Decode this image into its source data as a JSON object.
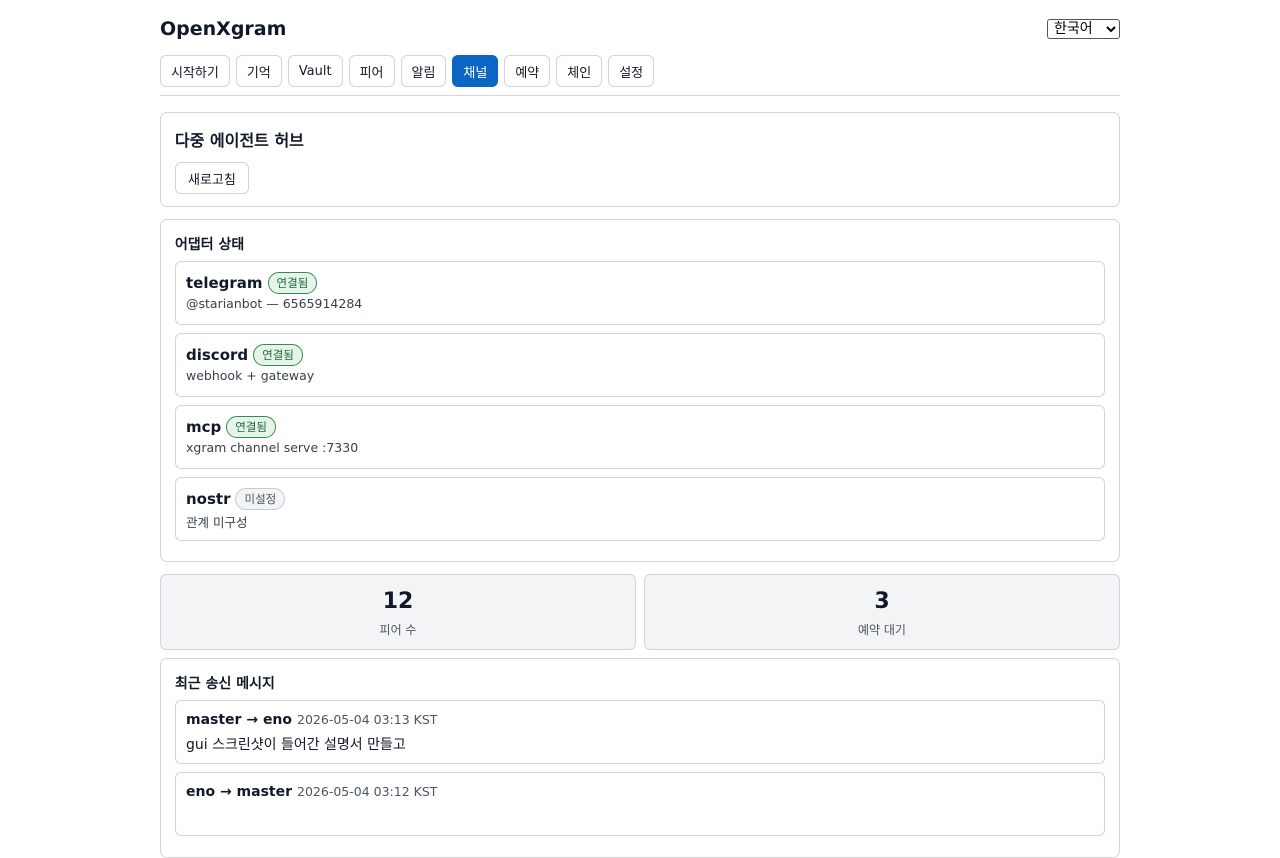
{
  "app": {
    "title": "OpenXgram",
    "language": "한국어"
  },
  "tabs": [
    {
      "label": "시작하기",
      "active": false
    },
    {
      "label": "기억",
      "active": false
    },
    {
      "label": "Vault",
      "active": false
    },
    {
      "label": "피어",
      "active": false
    },
    {
      "label": "알림",
      "active": false
    },
    {
      "label": "채널",
      "active": true
    },
    {
      "label": "예약",
      "active": false
    },
    {
      "label": "체인",
      "active": false
    },
    {
      "label": "설정",
      "active": false
    }
  ],
  "hub": {
    "title": "다중 에이전트 허브",
    "refresh_label": "새로고침"
  },
  "adapters": {
    "title": "어댑터 상태",
    "items": [
      {
        "name": "telegram",
        "status": "연결됨",
        "detail": "@starianbot — 6565914284"
      },
      {
        "name": "discord",
        "status": "연결됨",
        "detail": "webhook + gateway"
      },
      {
        "name": "mcp",
        "status": "연결됨",
        "detail": "xgram channel serve :7330"
      },
      {
        "name": "nostr",
        "status": "미설정",
        "detail": "관계 미구성"
      }
    ]
  },
  "stats": [
    {
      "value": "12",
      "label": "피어 수"
    },
    {
      "value": "3",
      "label": "예약 대기"
    }
  ],
  "messages": {
    "title": "최근 송신 메시지",
    "items": [
      {
        "route": "master → eno",
        "time": "2026-05-04 03:13 KST",
        "body": "gui 스크린샷이 들어간 설명서 만들고"
      },
      {
        "route": "eno → master",
        "time": "2026-05-04 03:12 KST",
        "body": ""
      }
    ]
  },
  "colors": {
    "accent": "#0a66c2",
    "connected": "#1e6b3a",
    "unset": "#4b5563"
  }
}
